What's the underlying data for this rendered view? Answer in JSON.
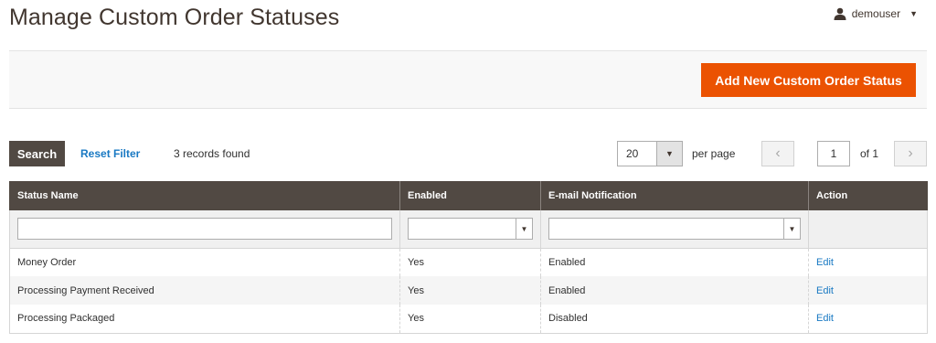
{
  "page": {
    "title": "Manage Custom Order Statuses"
  },
  "user": {
    "name": "demouser",
    "icon": "user-icon"
  },
  "actions": {
    "add_label": "Add New Custom Order Status",
    "accent": "#eb5202"
  },
  "toolbar": {
    "search_label": "Search",
    "reset_label": "Reset Filter",
    "records_text": "3 records found",
    "per_page_value": "20",
    "per_page_label": "per page",
    "current_page": "1",
    "page_total": "of 1"
  },
  "grid": {
    "columns": [
      "Status Name",
      "Enabled",
      "E-mail Notification",
      "Action"
    ],
    "rows": [
      {
        "status_name": "Money Order",
        "enabled": "Yes",
        "email": "Enabled",
        "action": "Edit"
      },
      {
        "status_name": "Processing Payment Received",
        "enabled": "Yes",
        "email": "Enabled",
        "action": "Edit"
      },
      {
        "status_name": "Processing Packaged",
        "enabled": "Yes",
        "email": "Disabled",
        "action": "Edit"
      }
    ]
  }
}
